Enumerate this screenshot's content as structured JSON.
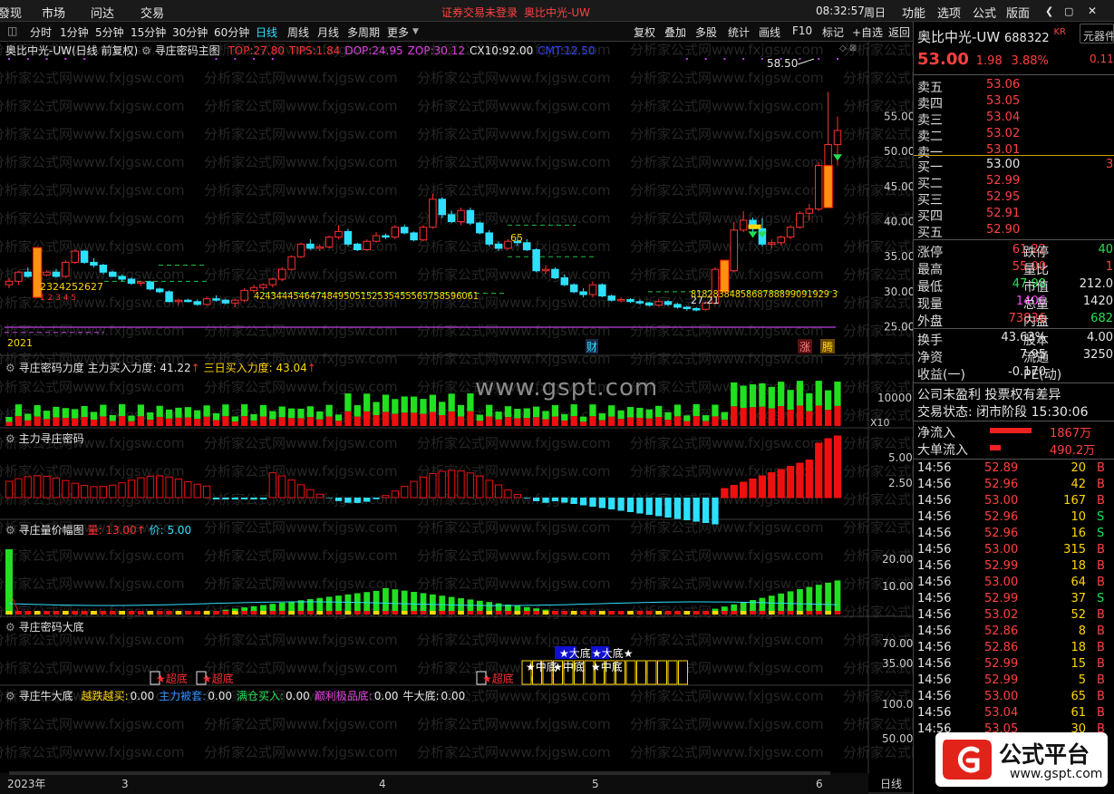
{
  "menubar": {
    "items": [
      "發现",
      "市场",
      "问达",
      "交易"
    ],
    "status_notice": "证券交易未登录",
    "stock": "奥比中光-UW",
    "time": "08:32:57",
    "weekday": "周日",
    "right_menu": [
      "功能",
      "选项",
      "公式",
      "版面"
    ]
  },
  "periods": [
    "分时",
    "1分钟",
    "5分钟",
    "15分钟",
    "30分钟",
    "60分钟",
    "日线",
    "周线",
    "月线",
    "多周期",
    "更多"
  ],
  "selected_period": "日线",
  "toolbar": [
    "复权",
    "叠加",
    "多股",
    "统计",
    "画线",
    "F10",
    "标记",
    "+自选",
    "返回"
  ],
  "main_panel": {
    "title": "奥比中光-UW(日线 前复权)",
    "indicator": "寻庄密码主图",
    "params": [
      {
        "k": "TOP:",
        "v": "27.80",
        "c": "#ff3030"
      },
      {
        "k": "TIPS:",
        "v": "1.84",
        "c": "#ff3030"
      },
      {
        "k": "DOP:",
        "v": "24.95",
        "c": "#e040e0"
      },
      {
        "k": "ZOP:",
        "v": "30.12",
        "c": "#e040e0"
      },
      {
        "k": "CX10:",
        "v": "92.00",
        "c": "#e6e6e6"
      },
      {
        "k": "CMT:",
        "v": "12.50",
        "c": "#3040ff"
      }
    ],
    "price_ticks": [
      "55.00",
      "50.00",
      "45.00",
      "40.00",
      "35.00",
      "30.00",
      "25.00"
    ],
    "high_label": "58.50",
    "low_label": "27.21",
    "year_label": "2021",
    "seq_left": "2324252627",
    "seq_small": "1 2 3 4 5",
    "seq_mid": "4243444546474849505152535455565758596061",
    "seq_right": "8182838485868788899091929 3",
    "mark_65": "65",
    "cai": "财",
    "zhang": "涨",
    "teng": "腾"
  },
  "panel1": {
    "name": "寻庄密码力度",
    "p1": "主力买入力度:",
    "v1": "41.22",
    "p2": "三日买入力度:",
    "v2": "43.04",
    "tick": "10000",
    "unit": "X10"
  },
  "panel2": {
    "name": "主力寻庄密码",
    "ticks": [
      "5.00",
      "2.50"
    ]
  },
  "panel3": {
    "name": "寻庄量价幅图",
    "p1": "量:",
    "v1": "13.00",
    "p2": "价:",
    "v2": "5.00",
    "ticks": [
      "20.00",
      "10.00"
    ]
  },
  "panel4": {
    "name": "寻庄密码大底",
    "ticks": [
      "70.00",
      "35.00"
    ],
    "labels": [
      "★大底",
      "★大底★",
      "★中底",
      "★中底",
      "★中底",
      "★超底",
      "★超底",
      "★超底",
      "★超底"
    ]
  },
  "panel5": {
    "name": "寻庄牛大底",
    "params": [
      {
        "k": "越跌越买:",
        "v": "0.00",
        "c": "#ffd700"
      },
      {
        "k": "主力被套:",
        "v": "0.00",
        "c": "#3090ff"
      },
      {
        "k": "满仓买入:",
        "v": "0.00",
        "c": "#20e050"
      },
      {
        "k": "巅利极品底:",
        "v": "0.00",
        "c": "#e040e0"
      },
      {
        "k": "牛大底:",
        "v": "0.00",
        "c": "#e6e6e6"
      }
    ],
    "ticks": [
      "100.0",
      "50.00"
    ]
  },
  "xaxis": {
    "labels": [
      "2023年",
      "3",
      "4",
      "5",
      "6"
    ],
    "right": "日线"
  },
  "watermark": "www.gspt.com",
  "watermark_tile": "分析家公式网www.fxjgsw.com",
  "quote": {
    "name": "奥比中光-UW",
    "code": "688322",
    "badge": "KR",
    "price": "53.00",
    "change": "1.98",
    "pct": "3.88%",
    "side_tab": "元器件",
    "side_val": "0.11%",
    "asks": [
      {
        "l": "卖五",
        "p": "53.06"
      },
      {
        "l": "卖四",
        "p": "53.05"
      },
      {
        "l": "卖三",
        "p": "53.04"
      },
      {
        "l": "卖二",
        "p": "53.02"
      },
      {
        "l": "卖一",
        "p": "53.01"
      }
    ],
    "bids": [
      {
        "l": "买一",
        "p": "53.00",
        "v": "3"
      },
      {
        "l": "买二",
        "p": "52.99"
      },
      {
        "l": "买三",
        "p": "52.95"
      },
      {
        "l": "买四",
        "p": "52.91"
      },
      {
        "l": "买五",
        "p": "52.90"
      }
    ],
    "stats": [
      {
        "a": "涨停",
        "av": "61.22",
        "ac": "#ff4040",
        "b": "跌停",
        "bv": "40",
        "bc": "#20e050"
      },
      {
        "a": "最高",
        "av": "55.00",
        "ac": "#ff4040",
        "b": "量比",
        "bv": "1",
        "bc": "#ff4040"
      },
      {
        "a": "最低",
        "av": "47.98",
        "ac": "#20e050",
        "b": "市值",
        "bv": "212.0",
        "bc": "#e6e6e6"
      },
      {
        "a": "现量",
        "av": "1406",
        "ac": "#ff40ff",
        "b": "总量",
        "bv": "1420",
        "bc": "#e6e6e6"
      },
      {
        "a": "外盘",
        "av": "73836",
        "ac": "#ff4040",
        "b": "内盘",
        "bv": "682",
        "bc": "#20e050"
      }
    ],
    "stats2": [
      {
        "a": "换手",
        "av": "43.63%",
        "b": "股本",
        "bv": "4.00"
      },
      {
        "a": "净资",
        "av": "7.95",
        "b": "流通",
        "bv": "3250"
      },
      {
        "a": "收益(一)",
        "av": "-0.170",
        "b": "PE(动)",
        "bv": ""
      }
    ],
    "notice1": "公司未盈利 投票权有差异",
    "notice2": "交易状态: 闭市阶段 15:30:06",
    "flow1": {
      "l": "净流入",
      "v": "1867万"
    },
    "flow2": {
      "l": "大单流入",
      "v": "490.2万"
    }
  },
  "ticks": [
    {
      "t": "14:56",
      "p": "52.89",
      "v": "20",
      "s": "B"
    },
    {
      "t": "14:56",
      "p": "52.96",
      "v": "42",
      "s": "B"
    },
    {
      "t": "14:56",
      "p": "53.00",
      "v": "167",
      "s": "B"
    },
    {
      "t": "14:56",
      "p": "52.96",
      "v": "10",
      "s": "S"
    },
    {
      "t": "14:56",
      "p": "52.96",
      "v": "16",
      "s": "S"
    },
    {
      "t": "14:56",
      "p": "53.00",
      "v": "315",
      "s": "B"
    },
    {
      "t": "14:56",
      "p": "52.99",
      "v": "18",
      "s": "B"
    },
    {
      "t": "14:56",
      "p": "53.00",
      "v": "64",
      "s": "B"
    },
    {
      "t": "14:56",
      "p": "52.99",
      "v": "37",
      "s": "S"
    },
    {
      "t": "14:56",
      "p": "53.02",
      "v": "52",
      "s": "B"
    },
    {
      "t": "14:56",
      "p": "52.86",
      "v": "8",
      "s": "B"
    },
    {
      "t": "14:56",
      "p": "52.86",
      "v": "18",
      "s": "B"
    },
    {
      "t": "14:56",
      "p": "52.99",
      "v": "15",
      "s": "B"
    },
    {
      "t": "14:56",
      "p": "52.99",
      "v": "5",
      "s": "B"
    },
    {
      "t": "14:56",
      "p": "53.00",
      "v": "65",
      "s": "B"
    },
    {
      "t": "14:56",
      "p": "53.04",
      "v": "61",
      "s": "B"
    },
    {
      "t": "14:56",
      "p": "53.05",
      "v": "30",
      "s": "B"
    }
  ],
  "logo": {
    "text": "公式平台",
    "url": "www.gspt.com",
    "icon": "g-logo-icon"
  },
  "chart_data": [
    {
      "type": "candlestick",
      "title": "奥比中光-UW(日线 前复权)",
      "ylim": [
        25,
        58.5
      ],
      "candles": [
        [
          31,
          32,
          30.5,
          31.5
        ],
        [
          31.5,
          33,
          31,
          32.8
        ],
        [
          32.8,
          33.5,
          32,
          32.2
        ],
        [
          32.2,
          32.5,
          31.8,
          32.4
        ],
        [
          32.4,
          33,
          32.2,
          32.8
        ],
        [
          32.8,
          33.2,
          32,
          32.2
        ],
        [
          32.2,
          34.5,
          32,
          34.2
        ],
        [
          34.2,
          36,
          34,
          35.8
        ],
        [
          35.8,
          36,
          34,
          34.2
        ],
        [
          34.2,
          34.8,
          33.5,
          33.8
        ],
        [
          33.8,
          34,
          32.5,
          32.8
        ],
        [
          32.8,
          33,
          32.1,
          32.2
        ],
        [
          32.2,
          32.5,
          31.5,
          31.8
        ],
        [
          31.8,
          32,
          31,
          31.2
        ],
        [
          31.2,
          31.5,
          30.8,
          31.4
        ],
        [
          31.4,
          31.6,
          30.2,
          30.4
        ],
        [
          30.4,
          30.6,
          29.8,
          30
        ],
        [
          30,
          30.2,
          28.5,
          28.6
        ],
        [
          28.6,
          29,
          28.1,
          28.8
        ],
        [
          28.8,
          29,
          28.5,
          28.6
        ],
        [
          28.6,
          28.9,
          28,
          28.2
        ],
        [
          28.2,
          29.3,
          28,
          29
        ],
        [
          29,
          29.5,
          28.6,
          28.8
        ],
        [
          28.8,
          29,
          28.2,
          28.4
        ],
        [
          28.4,
          29,
          27.8,
          28.8
        ],
        [
          28.8,
          30.5,
          28.5,
          30.2
        ],
        [
          30.2,
          31,
          29.8,
          30.6
        ],
        [
          30.6,
          31.2,
          30.2,
          31
        ],
        [
          31,
          32,
          30.6,
          31.8
        ],
        [
          31.8,
          33.5,
          31.5,
          33.2
        ],
        [
          33.2,
          35.2,
          33,
          35
        ],
        [
          35,
          37,
          34.8,
          36.8
        ],
        [
          36.8,
          37.5,
          36,
          36.2
        ],
        [
          36.2,
          36.8,
          35.8,
          36.4
        ],
        [
          36.4,
          38,
          36.2,
          37.8
        ],
        [
          37.8,
          39.5,
          37.5,
          38.6
        ],
        [
          38.6,
          39,
          36.5,
          36.8
        ],
        [
          36.8,
          37,
          35.8,
          36
        ],
        [
          36,
          37.5,
          35.8,
          37.2
        ],
        [
          37.2,
          38.5,
          37,
          38
        ],
        [
          38,
          38.3,
          37.5,
          37.8
        ],
        [
          37.8,
          39.5,
          37.5,
          39.2
        ],
        [
          39.2,
          39.6,
          38.2,
          38.4
        ],
        [
          38.4,
          38.6,
          37.2,
          37.4
        ],
        [
          37.4,
          39.5,
          37.2,
          39.2
        ],
        [
          39.2,
          44,
          39,
          43.2
        ],
        [
          43.2,
          43.5,
          40.5,
          41
        ],
        [
          41,
          41.6,
          39.8,
          40
        ],
        [
          40,
          42,
          39.5,
          41.6
        ],
        [
          41.6,
          42,
          39.5,
          39.8
        ],
        [
          39.8,
          40,
          38.2,
          38.4
        ],
        [
          38.4,
          38.8,
          36.5,
          36.8
        ],
        [
          36.8,
          37.2,
          35.8,
          36.2
        ],
        [
          36.2,
          37.5,
          36,
          37.2
        ],
        [
          37.2,
          37.8,
          36.5,
          37
        ],
        [
          37,
          37.5,
          35.8,
          36
        ],
        [
          36,
          36.2,
          32.8,
          33
        ],
        [
          33,
          33.8,
          32.5,
          33.2
        ],
        [
          33.2,
          33.5,
          31.8,
          32
        ],
        [
          32,
          32.5,
          30.8,
          31
        ],
        [
          31,
          31.2,
          29.8,
          30
        ],
        [
          30,
          30.5,
          29.2,
          29.6
        ],
        [
          29.6,
          31.5,
          29.2,
          31
        ],
        [
          31,
          31.2,
          29.2,
          29.4
        ],
        [
          29.4,
          29.6,
          28.6,
          28.8
        ],
        [
          28.8,
          29.2,
          28.5,
          28.9
        ],
        [
          28.9,
          29.1,
          28.4,
          28.6
        ],
        [
          28.6,
          28.9,
          28.2,
          28.4
        ],
        [
          28.4,
          28.6,
          27.9,
          28.1
        ],
        [
          28.1,
          28.9,
          27.9,
          28.6
        ],
        [
          28.6,
          28.8,
          28,
          28.2
        ],
        [
          28.2,
          28.4,
          27.6,
          27.8
        ],
        [
          27.8,
          28,
          27.3,
          27.6
        ],
        [
          27.6,
          27.8,
          27.21,
          27.5
        ],
        [
          27.5,
          28.6,
          27.3,
          28.4
        ],
        [
          28.4,
          33.5,
          28.2,
          33.2
        ],
        [
          33.2,
          33.5,
          32.6,
          33
        ],
        [
          33,
          40,
          32.8,
          38.8
        ],
        [
          38.8,
          41.5,
          38.5,
          40.2
        ],
        [
          40.2,
          40.6,
          38.5,
          39
        ],
        [
          39,
          40.5,
          36.5,
          36.8
        ],
        [
          36.8,
          37.5,
          36.2,
          37
        ],
        [
          37,
          38,
          36.6,
          37.8
        ],
        [
          37.8,
          39.5,
          37.5,
          39.2
        ],
        [
          39.2,
          41.5,
          39,
          41.2
        ],
        [
          41.2,
          42.5,
          40.2,
          41.8
        ],
        [
          41.8,
          48.5,
          41.5,
          48
        ],
        [
          48,
          58.5,
          47.5,
          51
        ],
        [
          51,
          55,
          47.98,
          53
        ]
      ],
      "ma_levels": [
        29.8,
        31.5,
        33.8,
        39.5,
        35
      ],
      "dop": 24.95
    }
  ]
}
